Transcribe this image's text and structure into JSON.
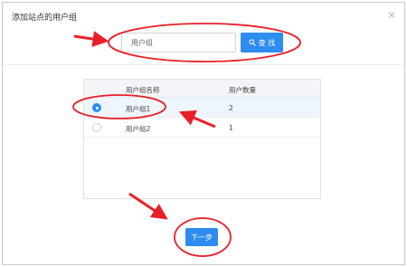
{
  "dialog": {
    "title": "添加站点的用户组",
    "close_icon": "close-icon"
  },
  "search": {
    "value": "用户组",
    "button_label": "查 找",
    "button_icon": "search-icon"
  },
  "table": {
    "columns": [
      "用户组名称",
      "用户数量"
    ],
    "rows": [
      {
        "name": "用户组1",
        "count": "2",
        "selected": true
      },
      {
        "name": "用户组2",
        "count": "1",
        "selected": false
      }
    ]
  },
  "footer": {
    "next_label": "下一步"
  },
  "colors": {
    "primary": "#2d8cf0",
    "annotation": "#e8202a"
  }
}
